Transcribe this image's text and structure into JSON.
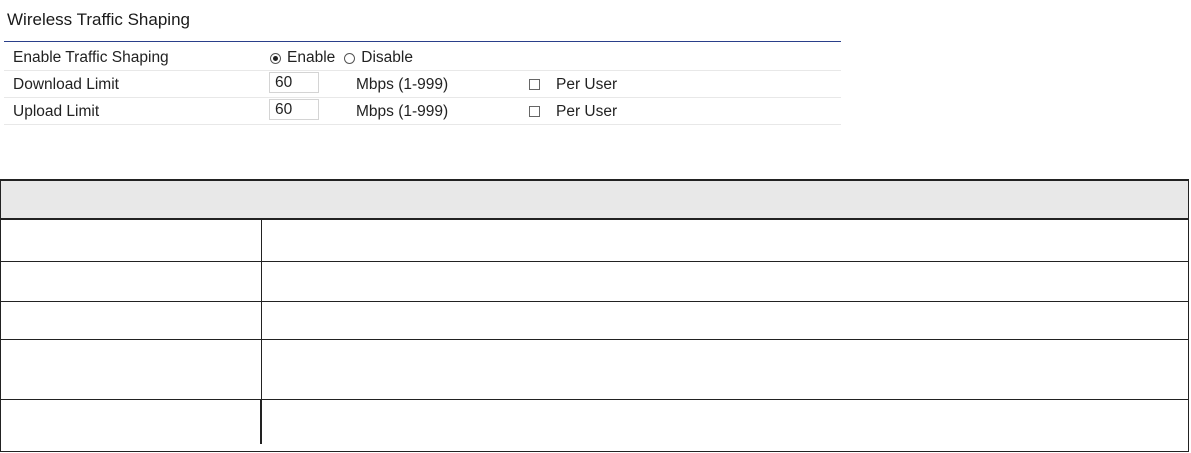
{
  "section": {
    "title": "Wireless Traffic Shaping"
  },
  "settings": {
    "enable_row": {
      "label": "Enable Traffic Shaping",
      "options": [
        {
          "label": "Enable",
          "checked": true
        },
        {
          "label": "Disable",
          "checked": false
        }
      ]
    },
    "download_row": {
      "label": "Download Limit",
      "value": "60",
      "unit": "Mbps (1-999)",
      "per_user_label": "Per User",
      "per_user_checked": false
    },
    "upload_row": {
      "label": "Upload Limit",
      "value": "60",
      "unit": "Mbps (1-999)",
      "per_user_label": "Per User",
      "per_user_checked": false
    }
  },
  "description_table": {
    "header": "",
    "rows": [
      {
        "field": "",
        "description": ""
      },
      {
        "field": "",
        "description": ""
      },
      {
        "field": "",
        "description": ""
      },
      {
        "field": "",
        "description": ""
      },
      {
        "field": "",
        "description": ""
      }
    ]
  },
  "colors": {
    "title_rule": "#2a3f8a",
    "table_header_bg": "#e8e8e8",
    "table_border": "#222222"
  }
}
